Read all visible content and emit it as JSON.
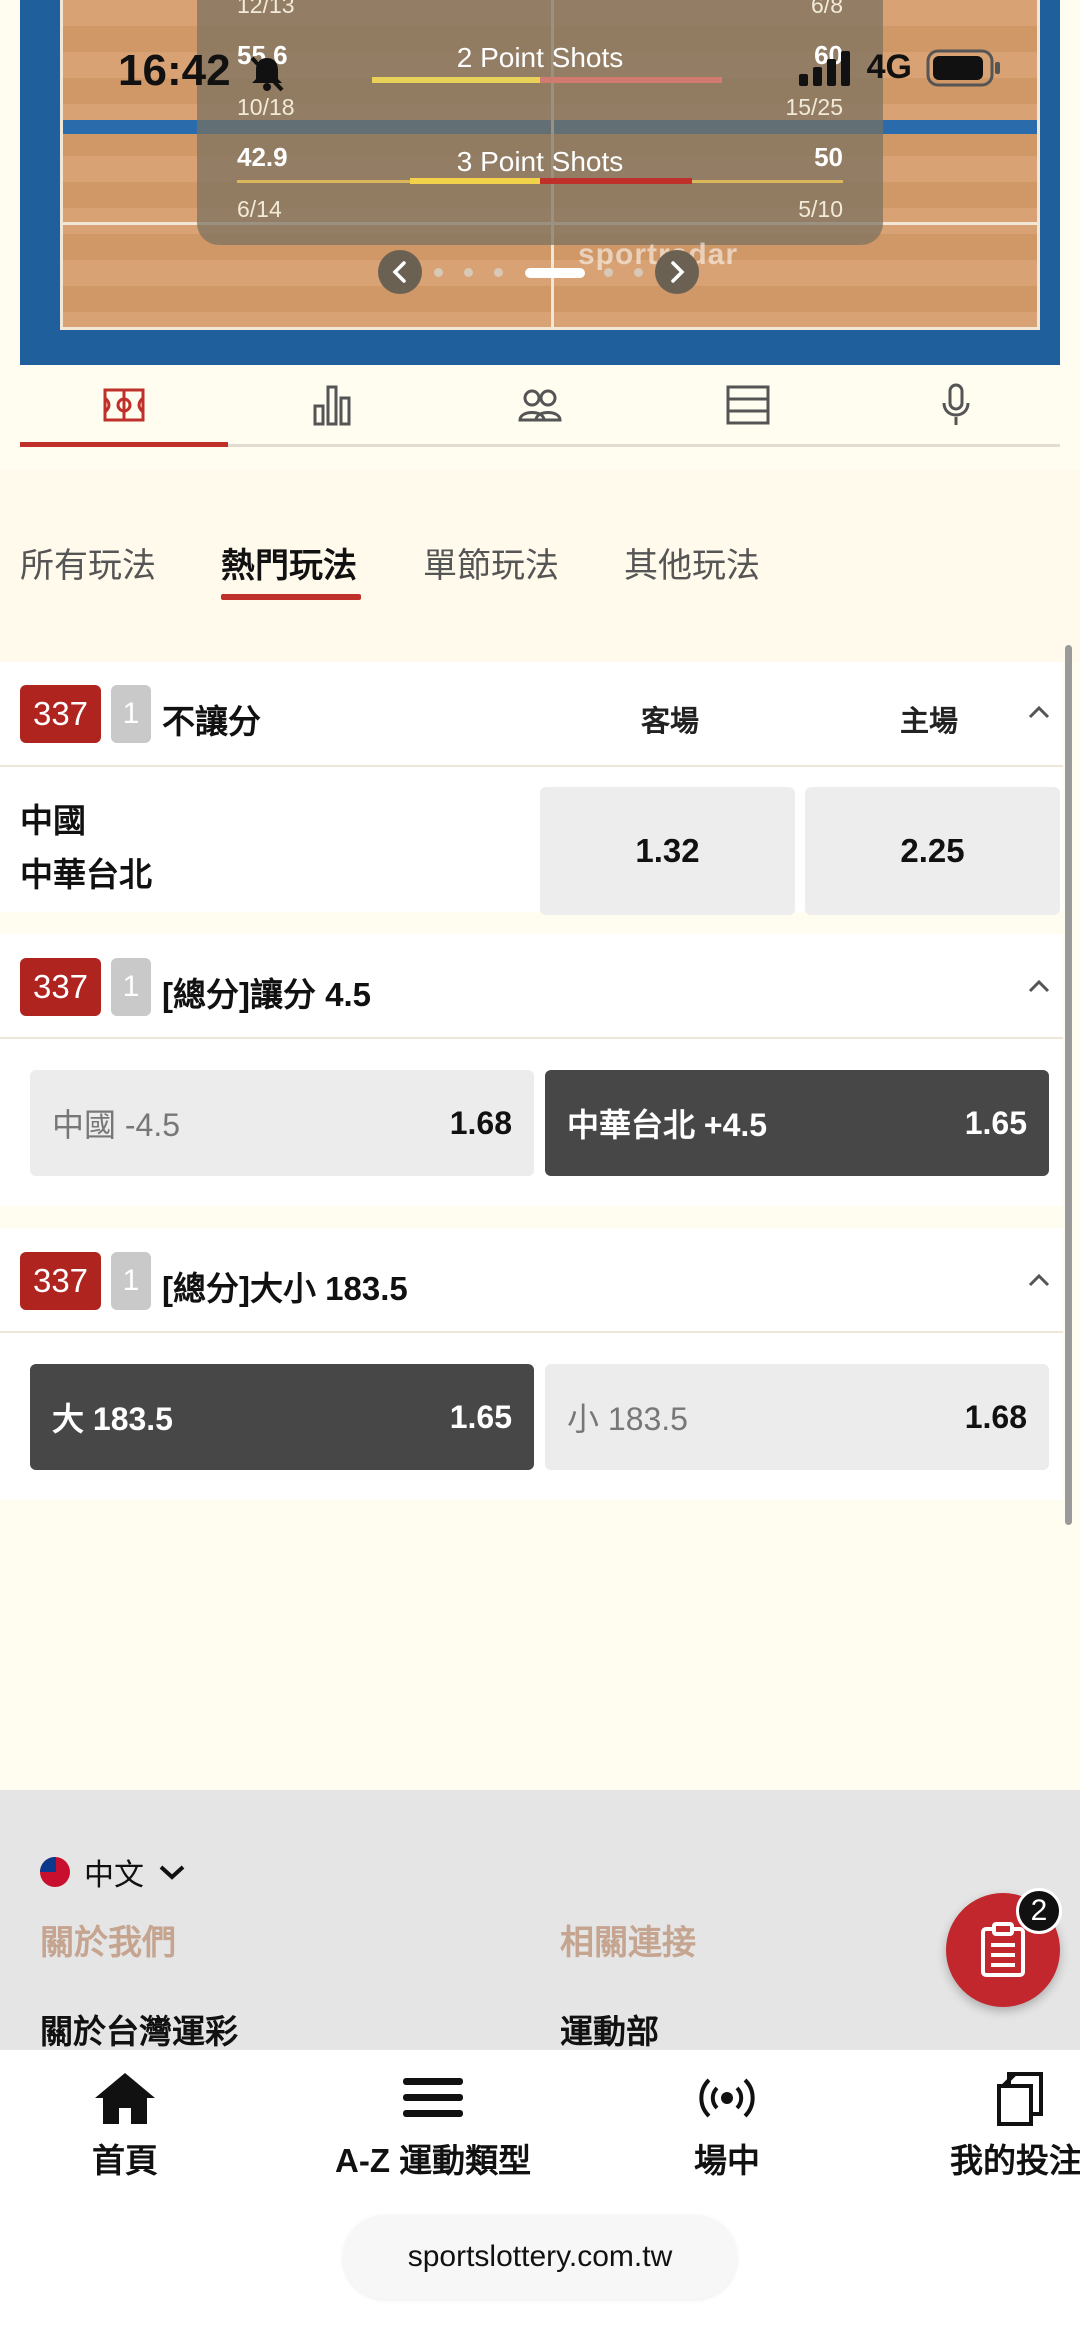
{
  "status_bar": {
    "time": "16:42",
    "network": "4G"
  },
  "stats_widget": {
    "row_prev": {
      "left_count": "12/13",
      "right_count": "6/8"
    },
    "two_point": {
      "title": "2 Point Shots",
      "left_pct": "55.6",
      "right_pct": "60",
      "pct_sign": "%",
      "left_count": "10/18",
      "right_count": "15/25",
      "left_fraction": 0.556,
      "right_fraction": 0.6
    },
    "three_point": {
      "title": "3 Point Shots",
      "left_pct": "42.9",
      "right_pct": "50",
      "pct_sign": "%",
      "left_count": "6/14",
      "right_count": "5/10",
      "left_fraction": 0.429,
      "right_fraction": 0.5
    },
    "watermark": "sportradar",
    "pager": {
      "page_count": 6,
      "active_index": 3
    }
  },
  "icon_tabs": [
    {
      "icon": "court-icon",
      "active": true
    },
    {
      "icon": "bar-chart-icon",
      "active": false
    },
    {
      "icon": "players-icon",
      "active": false
    },
    {
      "icon": "list-icon",
      "active": false
    },
    {
      "icon": "microphone-icon",
      "active": false
    }
  ],
  "categories": [
    "所有玩法",
    "熱門玩法",
    "單節玩法",
    "其他玩法"
  ],
  "active_category": "熱門玩法",
  "markets": {
    "moneyline": {
      "game_no": "337",
      "period": "1",
      "title": "不讓分",
      "col_away": "客場",
      "col_home": "主場",
      "team_away": "中國",
      "team_home": "中華台北",
      "odd_away": "1.32",
      "odd_home": "2.25"
    },
    "handicap": {
      "game_no": "337",
      "period": "1",
      "title": "[總分]讓分 4.5",
      "left_label": "中國 -4.5",
      "left_odd": "1.68",
      "right_label": "中華台北 +4.5",
      "right_odd": "1.65"
    },
    "total": {
      "game_no": "337",
      "period": "1",
      "title": "[總分]大小 183.5",
      "left_label": "大 183.5",
      "left_odd": "1.65",
      "right_label": "小 183.5",
      "right_odd": "1.68"
    }
  },
  "footer": {
    "language": "中文",
    "col1_heading": "關於我們",
    "col1_link": "關於台灣運彩",
    "col2_heading": "相關連接",
    "col2_link": "運動部",
    "betslip_count": "2"
  },
  "bottom_nav": [
    {
      "label": "首頁",
      "icon": "home-icon"
    },
    {
      "label": "A-Z 運動類型",
      "icon": "menu-icon"
    },
    {
      "label": "場中",
      "icon": "live-icon"
    },
    {
      "label": "我的投注",
      "icon": "bets-icon"
    }
  ],
  "url": "sportslottery.com.tw",
  "colors": {
    "accent": "#c0302a",
    "badge_red": "#b0241f",
    "bar_yellow": "#f1d24a",
    "bar_red": "#c0302a"
  }
}
